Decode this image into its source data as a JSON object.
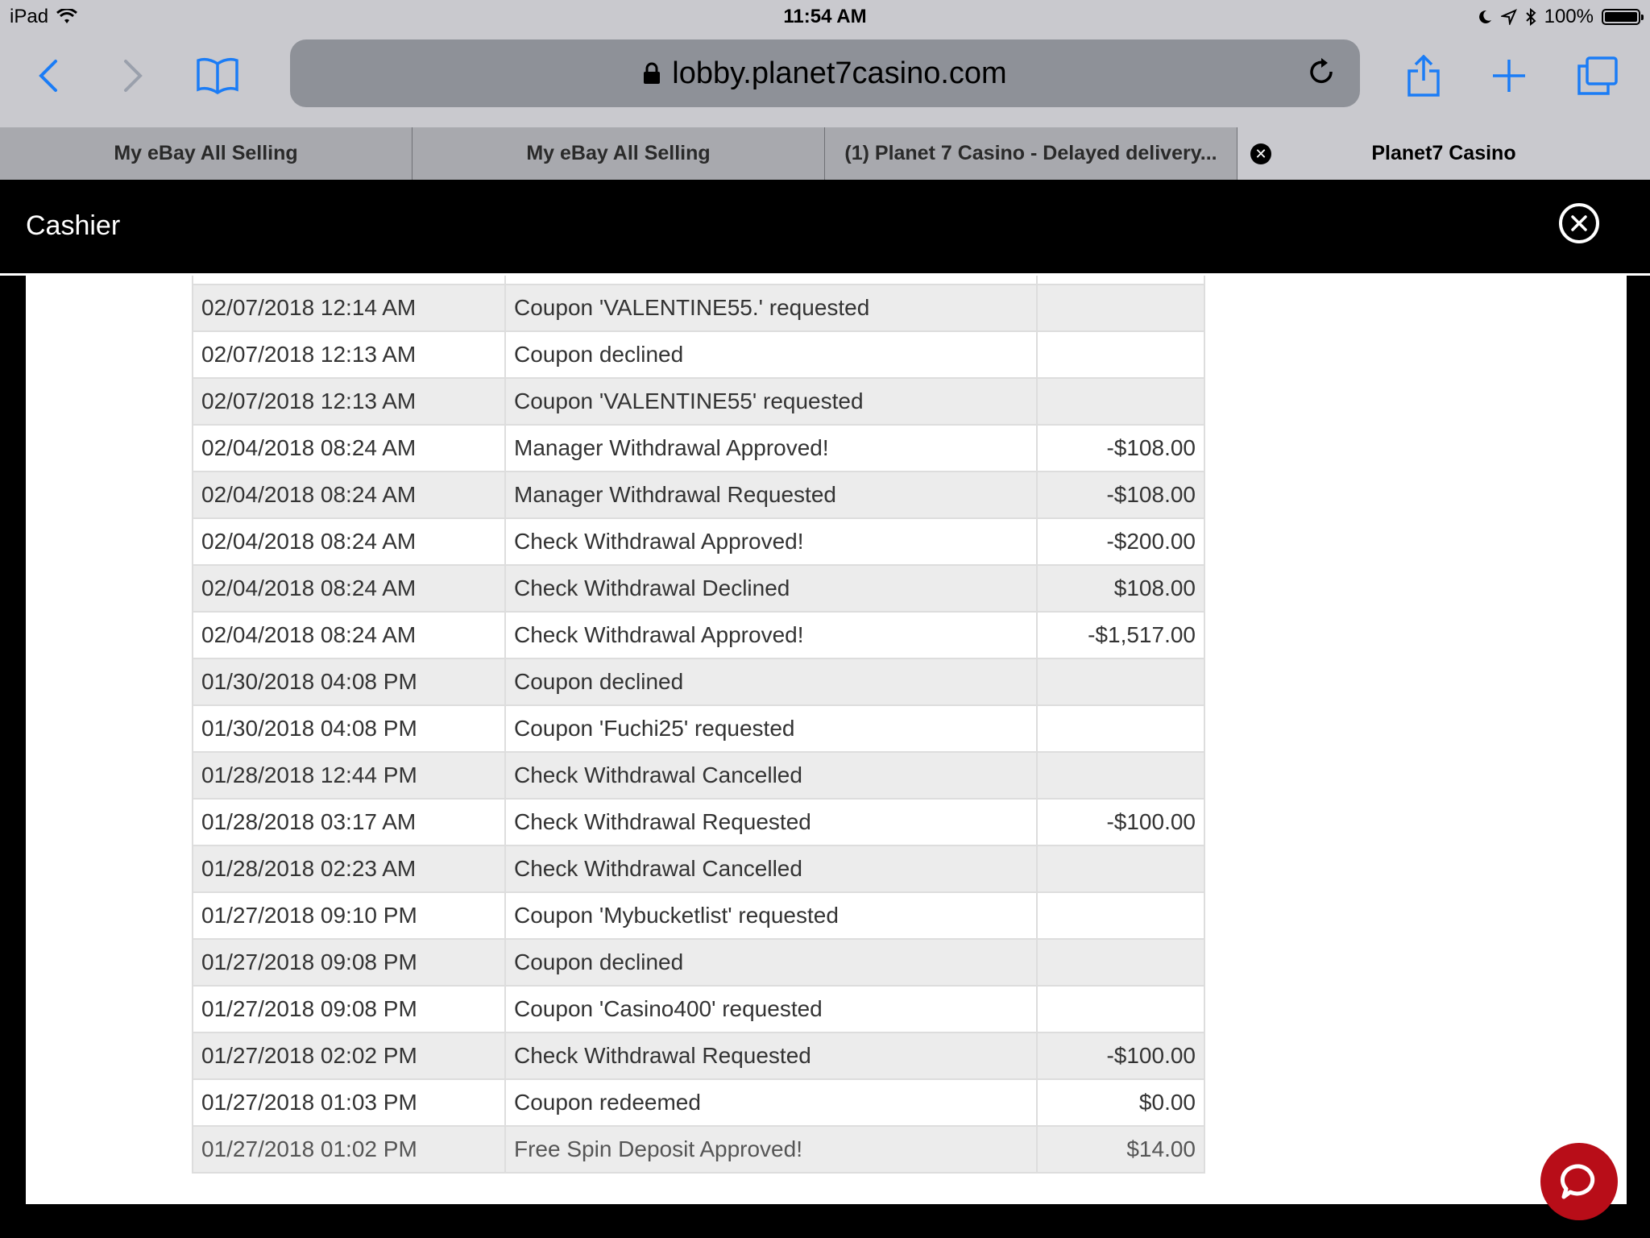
{
  "status": {
    "device": "iPad",
    "time": "11:54 AM",
    "battery": "100%"
  },
  "browser": {
    "url": "lobby.planet7casino.com",
    "tabs": [
      {
        "label": "My eBay All Selling"
      },
      {
        "label": "My eBay All Selling"
      },
      {
        "label": "(1) Planet 7 Casino - Delayed delivery..."
      },
      {
        "label": "Planet7 Casino"
      }
    ]
  },
  "cashier": {
    "title": "Cashier"
  },
  "transactions": [
    {
      "date": "02/07/2018 12:14 AM",
      "desc": "Coupon 'VALENTINE55.' requested",
      "amount": ""
    },
    {
      "date": "02/07/2018 12:13 AM",
      "desc": "Coupon declined",
      "amount": ""
    },
    {
      "date": "02/07/2018 12:13 AM",
      "desc": "Coupon 'VALENTINE55' requested",
      "amount": ""
    },
    {
      "date": "02/04/2018 08:24 AM",
      "desc": "Manager Withdrawal Approved!",
      "amount": "-$108.00"
    },
    {
      "date": "02/04/2018 08:24 AM",
      "desc": "Manager Withdrawal Requested",
      "amount": "-$108.00"
    },
    {
      "date": "02/04/2018 08:24 AM",
      "desc": "Check Withdrawal Approved!",
      "amount": "-$200.00"
    },
    {
      "date": "02/04/2018 08:24 AM",
      "desc": "Check Withdrawal Declined",
      "amount": "$108.00"
    },
    {
      "date": "02/04/2018 08:24 AM",
      "desc": "Check Withdrawal Approved!",
      "amount": "-$1,517.00"
    },
    {
      "date": "01/30/2018 04:08 PM",
      "desc": "Coupon declined",
      "amount": ""
    },
    {
      "date": "01/30/2018 04:08 PM",
      "desc": "Coupon 'Fuchi25' requested",
      "amount": ""
    },
    {
      "date": "01/28/2018 12:44 PM",
      "desc": "Check Withdrawal Cancelled",
      "amount": ""
    },
    {
      "date": "01/28/2018 03:17 AM",
      "desc": "Check Withdrawal Requested",
      "amount": "-$100.00"
    },
    {
      "date": "01/28/2018 02:23 AM",
      "desc": "Check Withdrawal Cancelled",
      "amount": ""
    },
    {
      "date": "01/27/2018 09:10 PM",
      "desc": "Coupon 'Mybucketlist' requested",
      "amount": ""
    },
    {
      "date": "01/27/2018 09:08 PM",
      "desc": "Coupon declined",
      "amount": ""
    },
    {
      "date": "01/27/2018 09:08 PM",
      "desc": "Coupon 'Casino400' requested",
      "amount": ""
    },
    {
      "date": "01/27/2018 02:02 PM",
      "desc": "Check Withdrawal Requested",
      "amount": "-$100.00"
    },
    {
      "date": "01/27/2018 01:03 PM",
      "desc": "Coupon redeemed",
      "amount": "$0.00"
    },
    {
      "date": "01/27/2018 01:02 PM",
      "desc": "Free Spin Deposit Approved!",
      "amount": "$14.00"
    }
  ]
}
